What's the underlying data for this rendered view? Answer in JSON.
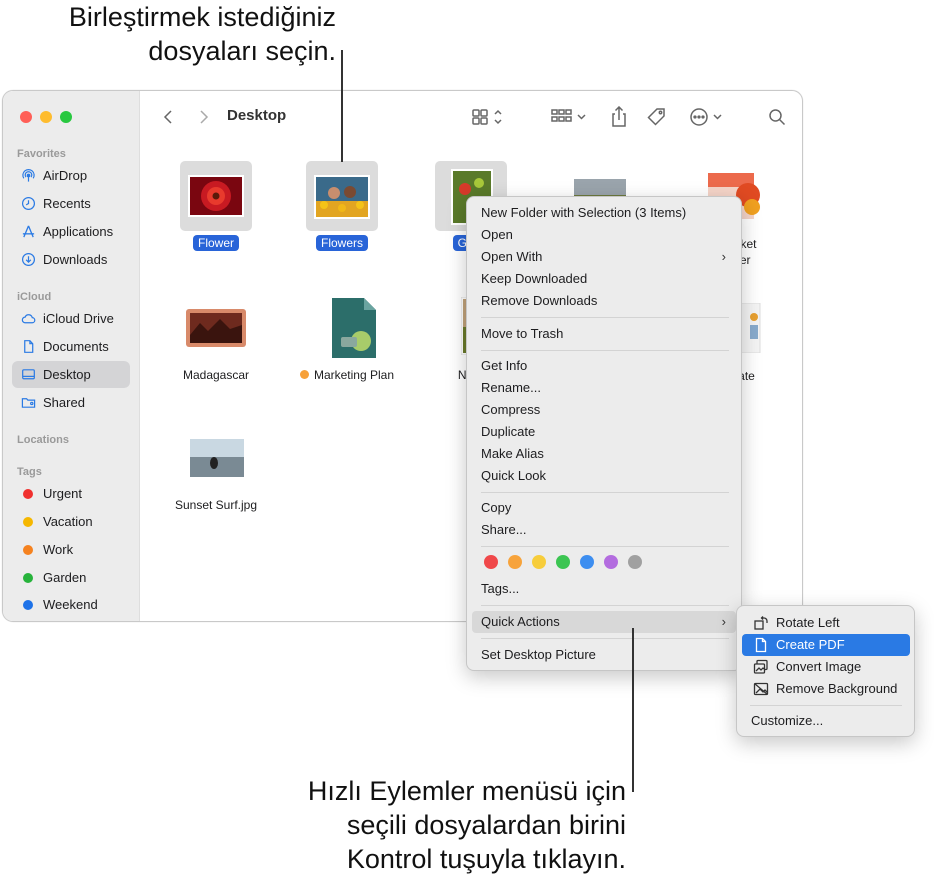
{
  "callouts": {
    "top_line1": "Birleştirmek istediğiniz",
    "top_line2": "dosyaları seçin.",
    "bottom_line1": "Hızlı Eylemler menüsü için",
    "bottom_line2": "seçili dosyalardan birini",
    "bottom_line3": "Kontrol tuşuyla tıklayın."
  },
  "window": {
    "title": "Desktop"
  },
  "sidebar": {
    "sections": {
      "favorites": "Favorites",
      "icloud": "iCloud",
      "locations": "Locations",
      "tags": "Tags"
    },
    "favorites": [
      {
        "label": "AirDrop",
        "icon": "airdrop-icon"
      },
      {
        "label": "Recents",
        "icon": "clock-icon"
      },
      {
        "label": "Applications",
        "icon": "applications-icon"
      },
      {
        "label": "Downloads",
        "icon": "download-icon"
      }
    ],
    "icloud": [
      {
        "label": "iCloud Drive",
        "icon": "cloud-icon"
      },
      {
        "label": "Documents",
        "icon": "document-icon"
      },
      {
        "label": "Desktop",
        "icon": "desktop-icon"
      },
      {
        "label": "Shared",
        "icon": "shared-folder-icon"
      }
    ],
    "tags": [
      {
        "label": "Urgent",
        "color": "#f0302e"
      },
      {
        "label": "Vacation",
        "color": "#f5b700"
      },
      {
        "label": "Work",
        "color": "#f5821f"
      },
      {
        "label": "Garden",
        "color": "#27b33b"
      },
      {
        "label": "Weekend",
        "color": "#1e72e8"
      }
    ]
  },
  "files": [
    {
      "name": "Flower",
      "selected": true
    },
    {
      "name": "Flowers",
      "selected": true
    },
    {
      "name": "Gard",
      "selected": true
    },
    {
      "name": "",
      "selected": false
    },
    {
      "name": "rket\nter",
      "selected": false
    },
    {
      "name": "Madagascar",
      "selected": false
    },
    {
      "name": "Marketing Plan",
      "selected": false,
      "tag_color": "#f7a13a"
    },
    {
      "name": "Na",
      "selected": false
    },
    {
      "name": "ate\nt",
      "selected": false
    },
    {
      "name": "Sunset Surf.jpg",
      "selected": false
    }
  ],
  "context_menu": {
    "items": [
      "New Folder with Selection (3 Items)",
      "Open",
      "Open With",
      "Keep Downloaded",
      "Remove Downloads",
      "Move to Trash",
      "Get Info",
      "Rename...",
      "Compress",
      "Duplicate",
      "Make Alias",
      "Quick Look",
      "Copy",
      "Share...",
      "Tags...",
      "Quick Actions",
      "Set Desktop Picture"
    ],
    "tag_colors": [
      "#f0484a",
      "#f7a33b",
      "#f7cd3b",
      "#3cc552",
      "#3d8ef0",
      "#b36cdf",
      "#a0a0a0"
    ],
    "submenu_arrow": "›"
  },
  "quick_actions_menu": {
    "items": [
      {
        "label": "Rotate Left",
        "icon": "rotate-left-icon"
      },
      {
        "label": "Create PDF",
        "icon": "pdf-icon"
      },
      {
        "label": "Convert Image",
        "icon": "convert-image-icon"
      },
      {
        "label": "Remove Background",
        "icon": "remove-background-icon"
      }
    ],
    "customize": "Customize..."
  }
}
